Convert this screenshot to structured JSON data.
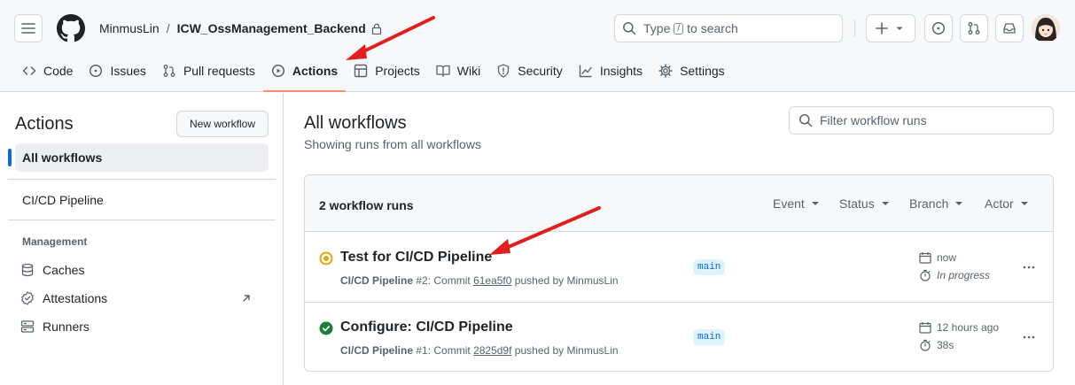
{
  "header": {
    "owner": "MinmusLin",
    "separator": "/",
    "repo": "ICW_OssManagement_Backend",
    "search": {
      "prefix": "Type",
      "kbd": "/",
      "suffix": "to search"
    }
  },
  "nav": {
    "tabs": [
      {
        "label": "Code",
        "icon": "code-icon"
      },
      {
        "label": "Issues",
        "icon": "issue-icon"
      },
      {
        "label": "Pull requests",
        "icon": "pull-request-icon"
      },
      {
        "label": "Actions",
        "icon": "play-icon",
        "selected": true
      },
      {
        "label": "Projects",
        "icon": "table-icon"
      },
      {
        "label": "Wiki",
        "icon": "book-icon"
      },
      {
        "label": "Security",
        "icon": "shield-icon"
      },
      {
        "label": "Insights",
        "icon": "graph-icon"
      },
      {
        "label": "Settings",
        "icon": "gear-icon"
      }
    ]
  },
  "sidebar": {
    "title": "Actions",
    "new_workflow": "New workflow",
    "all_workflows": "All workflows",
    "workflow": "CI/CD Pipeline",
    "management_heading": "Management",
    "management_links": [
      "Caches",
      "Attestations",
      "Runners"
    ]
  },
  "main": {
    "title": "All workflows",
    "subtitle": "Showing runs from all workflows",
    "filter_placeholder": "Filter workflow runs",
    "runs_count": "2 workflow runs",
    "filters": [
      "Event",
      "Status",
      "Branch",
      "Actor"
    ],
    "runs": [
      {
        "title": "Test for CI/CD Pipeline",
        "workflow": "CI/CD Pipeline",
        "meta_number": "#2: Commit",
        "sha": "61ea5f0",
        "meta_suffix": "pushed by MinmusLin",
        "branch": "main",
        "time": "now",
        "duration": "In progress",
        "status": "in-progress"
      },
      {
        "title": "Configure: CI/CD Pipeline",
        "workflow": "CI/CD Pipeline",
        "meta_number": "#1: Commit",
        "sha": "2825d9f",
        "meta_suffix": "pushed by MinmusLin",
        "branch": "main",
        "time": "12 hours ago",
        "duration": "38s",
        "status": "success"
      }
    ]
  },
  "colors": {
    "accent": "#0969da",
    "success": "#1a7f37",
    "in_progress": "#dbab09",
    "annotation": "#e02020",
    "tab_underline": "#fd8c73"
  }
}
